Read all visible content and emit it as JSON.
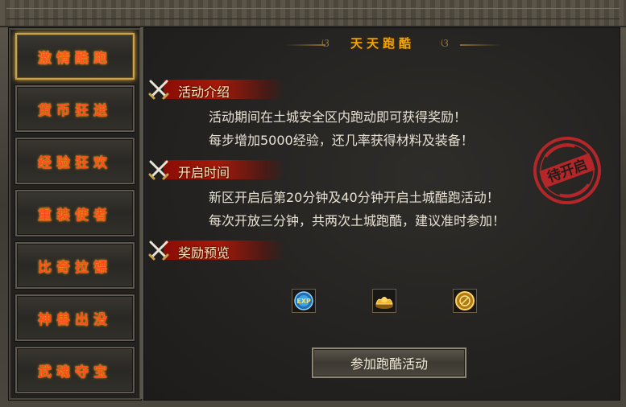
{
  "sidebar": {
    "items": [
      {
        "label": "激情酷跑",
        "active": true
      },
      {
        "label": "货币狂送"
      },
      {
        "label": "经验狂欢"
      },
      {
        "label": "重装使者"
      },
      {
        "label": "比奇拉镖"
      },
      {
        "label": "神兽出没"
      },
      {
        "label": "武魂夺宝"
      }
    ]
  },
  "panel": {
    "title": "天天跑酷",
    "sections": [
      {
        "heading": "活动介绍",
        "lines": [
          "活动期间在土城安全区内跑动即可获得奖励！",
          "每步增加5000经验，还几率获得材料及装备！"
        ]
      },
      {
        "heading": "开启时间",
        "lines": [
          "新区开启后第20分钟及40分钟开启土城酷跑活动！",
          "每次开放三分钟，共两次土城跑酷，建议准时参加！"
        ]
      },
      {
        "heading": "奖励预览",
        "lines": []
      }
    ],
    "stamp_text": "待开启",
    "rewards": [
      {
        "icon": "exp-icon",
        "text": "EXP"
      },
      {
        "icon": "gold-ingot-icon"
      },
      {
        "icon": "coin-icon"
      }
    ],
    "join_label": "参加跑酷活动"
  },
  "colors": {
    "accent": "#f0a500",
    "menu_text": "#ff4a1c",
    "ribbon": "#a5190a",
    "stamp": "#c5262a"
  }
}
